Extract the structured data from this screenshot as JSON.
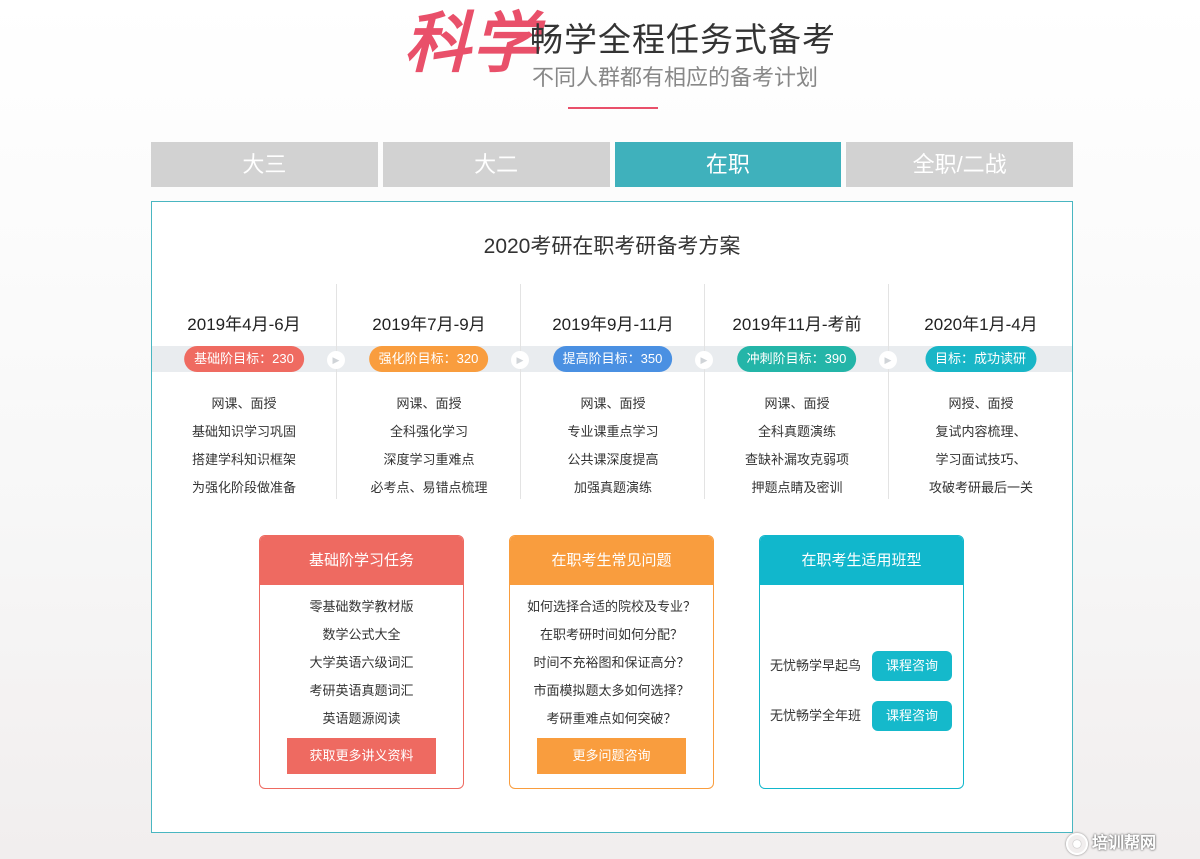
{
  "header": {
    "big_title": "科学",
    "main_title": "畅学全程任务式备考",
    "sub_title": "不同人群都有相应的备考计划"
  },
  "tabs": [
    {
      "label": "大三",
      "active": false
    },
    {
      "label": "大二",
      "active": false
    },
    {
      "label": "在职",
      "active": true
    },
    {
      "label": "全职/二战",
      "active": false
    }
  ],
  "colors": {
    "accent": "#e9506a",
    "tab_active": "#3fb1bc",
    "tab_inactive": "#d2d2d2",
    "badge_colors": [
      "#ef6b61",
      "#f99d3e",
      "#4a90e2",
      "#24b5a8",
      "#19b6c7"
    ]
  },
  "plan": {
    "title": "2020考研在职考研备考方案",
    "phases": [
      {
        "date": "2019年4月-6月",
        "badge": "基础阶目标：230",
        "items": [
          "网课、面授",
          "基础知识学习巩固",
          "搭建学科知识框架",
          "为强化阶段做准备"
        ]
      },
      {
        "date": "2019年7月-9月",
        "badge": "强化阶目标：320",
        "items": [
          "网课、面授",
          "全科强化学习",
          "深度学习重难点",
          "必考点、易错点梳理"
        ]
      },
      {
        "date": "2019年9月-11月",
        "badge": "提高阶目标：350",
        "items": [
          "网课、面授",
          "专业课重点学习",
          "公共课深度提高",
          "加强真题演练"
        ]
      },
      {
        "date": "2019年11月-考前",
        "badge": "冲刺阶目标：390",
        "items": [
          "网课、面授",
          "全科真题演练",
          "查缺补漏攻克弱项",
          "押题点睛及密训"
        ]
      },
      {
        "date": "2020年1月-4月",
        "badge": "目标：成功读研",
        "items": [
          "网授、面授",
          "复试内容梳理、",
          "学习面试技巧、",
          "攻破考研最后一关"
        ]
      }
    ]
  },
  "cards": {
    "basic": {
      "title": "基础阶学习任务",
      "items": [
        "零基础数学教材版",
        "数学公式大全",
        "大学英语六级词汇",
        "考研英语真题词汇",
        "英语题源阅读"
      ],
      "button": "获取更多讲义资料"
    },
    "faq": {
      "title": "在职考生常见问题",
      "items": [
        "如何选择合适的院校及专业？",
        "在职考研时间如何分配？",
        "时间不充裕图和保证高分？",
        "市面模拟题太多如何选择？",
        "考研重难点如何突破？"
      ],
      "button": "更多问题咨询"
    },
    "classes": {
      "title": "在职考生适用班型",
      "rows": [
        {
          "name": "无忧畅学早起鸟",
          "button": "课程咨询"
        },
        {
          "name": "无忧畅学全年班",
          "button": "课程咨询"
        }
      ]
    }
  },
  "watermark": "培训帮网"
}
